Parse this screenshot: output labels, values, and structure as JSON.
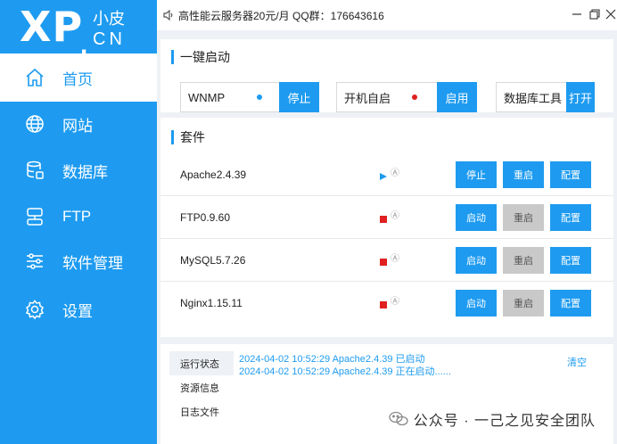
{
  "logo": {
    "main": "XP",
    "dot": ".",
    "small_top": "小皮",
    "small_bottom": "CN"
  },
  "sidebar": {
    "items": [
      {
        "label": "首页",
        "icon": "home-icon",
        "active": true
      },
      {
        "label": "网站",
        "icon": "globe-icon",
        "active": false
      },
      {
        "label": "数据库",
        "icon": "database-icon",
        "active": false
      },
      {
        "label": "FTP",
        "icon": "ftp-icon",
        "active": false
      },
      {
        "label": "软件管理",
        "icon": "sliders-icon",
        "active": false
      },
      {
        "label": "设置",
        "icon": "gear-icon",
        "active": false
      }
    ]
  },
  "titlebar": {
    "text": "高性能云服务器20元/月  QQ群：176643616",
    "buttons": [
      "minimize",
      "restore",
      "close"
    ]
  },
  "quickstart": {
    "title": "一键启动",
    "boxes": [
      {
        "label": "WNMP",
        "status_color": "#1e9bf0",
        "button": "停止"
      },
      {
        "label": "开机自启",
        "status_color": "#e02020",
        "button": "启用"
      },
      {
        "label": "数据库工具",
        "button": "打开"
      }
    ]
  },
  "packages": {
    "title": "套件",
    "rows": [
      {
        "name": "Apache2.4.39",
        "state": "running",
        "btn1": "停止",
        "btn2": "重启",
        "btn3": "配置",
        "btn2_enabled": true
      },
      {
        "name": "FTP0.9.60",
        "state": "stopped",
        "btn1": "启动",
        "btn2": "重启",
        "btn3": "配置",
        "btn2_enabled": false
      },
      {
        "name": "MySQL5.7.26",
        "state": "stopped",
        "btn1": "启动",
        "btn2": "重启",
        "btn3": "配置",
        "btn2_enabled": false
      },
      {
        "name": "Nginx1.15.11",
        "state": "stopped",
        "btn1": "启动",
        "btn2": "重启",
        "btn3": "配置",
        "btn2_enabled": false
      }
    ],
    "auto_symbol": "Ⓐ"
  },
  "logs": {
    "tabs": [
      "运行状态",
      "资源信息",
      "日志文件"
    ],
    "active_tab": 0,
    "lines": [
      "2024-04-02 10:52:29 Apache2.4.39 已启动",
      "2024-04-02 10:52:29 Apache2.4.39 正在启动......"
    ],
    "clear_label": "清空"
  },
  "watermark": {
    "text": "公众号 · 一己之见安全团队"
  },
  "colors": {
    "accent": "#1e9bf0",
    "stopped": "#e02020",
    "disabled": "#c9c9c9"
  }
}
